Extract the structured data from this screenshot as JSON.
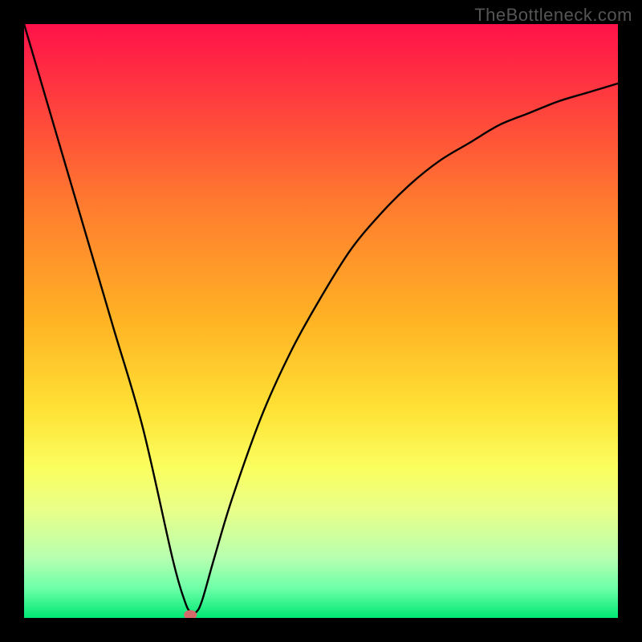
{
  "watermark": "TheBottleneck.com",
  "chart_data": {
    "type": "line",
    "title": "",
    "xlabel": "",
    "ylabel": "",
    "xlim": [
      0,
      100
    ],
    "ylim": [
      0,
      100
    ],
    "grid": false,
    "legend": false,
    "series": [
      {
        "name": "curve",
        "x": [
          0,
          5,
          10,
          15,
          20,
          25,
          27,
          28,
          29,
          30,
          32,
          35,
          40,
          45,
          50,
          55,
          60,
          65,
          70,
          75,
          80,
          85,
          90,
          95,
          100
        ],
        "y": [
          100,
          83,
          66,
          49,
          32,
          10,
          3,
          1,
          1,
          3,
          10,
          20,
          34,
          45,
          54,
          62,
          68,
          73,
          77,
          80,
          83,
          85,
          87,
          88.5,
          90
        ]
      }
    ],
    "marker": {
      "x": 28,
      "y": 0.5
    },
    "background_gradient": {
      "stops": [
        {
          "pct": 0,
          "color": "#ff124a"
        },
        {
          "pct": 12,
          "color": "#ff3a3f"
        },
        {
          "pct": 30,
          "color": "#ff7a2f"
        },
        {
          "pct": 50,
          "color": "#ffb324"
        },
        {
          "pct": 65,
          "color": "#ffe235"
        },
        {
          "pct": 75,
          "color": "#faff60"
        },
        {
          "pct": 82,
          "color": "#e8ff8a"
        },
        {
          "pct": 90,
          "color": "#b6ffb0"
        },
        {
          "pct": 95,
          "color": "#6effa8"
        },
        {
          "pct": 100,
          "color": "#00e874"
        }
      ]
    },
    "marker_color": "#d46a6a",
    "curve_color": "#000000"
  }
}
